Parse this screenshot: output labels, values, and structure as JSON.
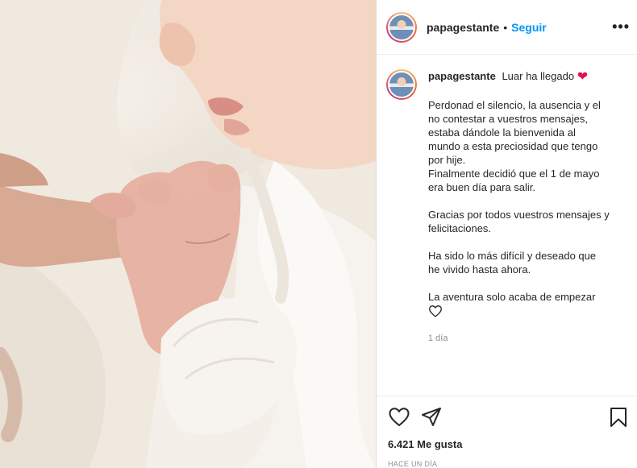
{
  "post": {
    "username": "papagestante",
    "follow_separator": "•",
    "follow_label": "Seguir",
    "more_label": "•••",
    "caption": {
      "title": "Luar ha llegado",
      "heart_icon": "red-heart-emoji",
      "paragraphs": [
        "Perdonad el silencio, la ausencia y el\nno contestar a vuestros mensajes,\nestaba dándole la bienvenida al\nmundo a esta preciosidad que tengo\npor hije.\nFinalmente decidió que el 1 de mayo\nera buen día para salir.",
        "Gracias por todos vuestros mensajes y\nfelicitaciones.",
        "Ha sido lo más difícil y deseado que\nhe vivido hasta ahora.",
        "La aventura solo acaba de empezar"
      ],
      "trailing_icon": "outline-heart-emoji",
      "time": "1 día"
    },
    "likes": "6.421 Me gusta",
    "timestamp": "HACE UN DÍA",
    "icons": {
      "like": "heart-outline-icon",
      "share": "paper-plane-icon",
      "save": "bookmark-icon"
    },
    "colors": {
      "follow": "#0095f6",
      "heart": "#e0144c",
      "muted": "#8e8e8e"
    }
  }
}
